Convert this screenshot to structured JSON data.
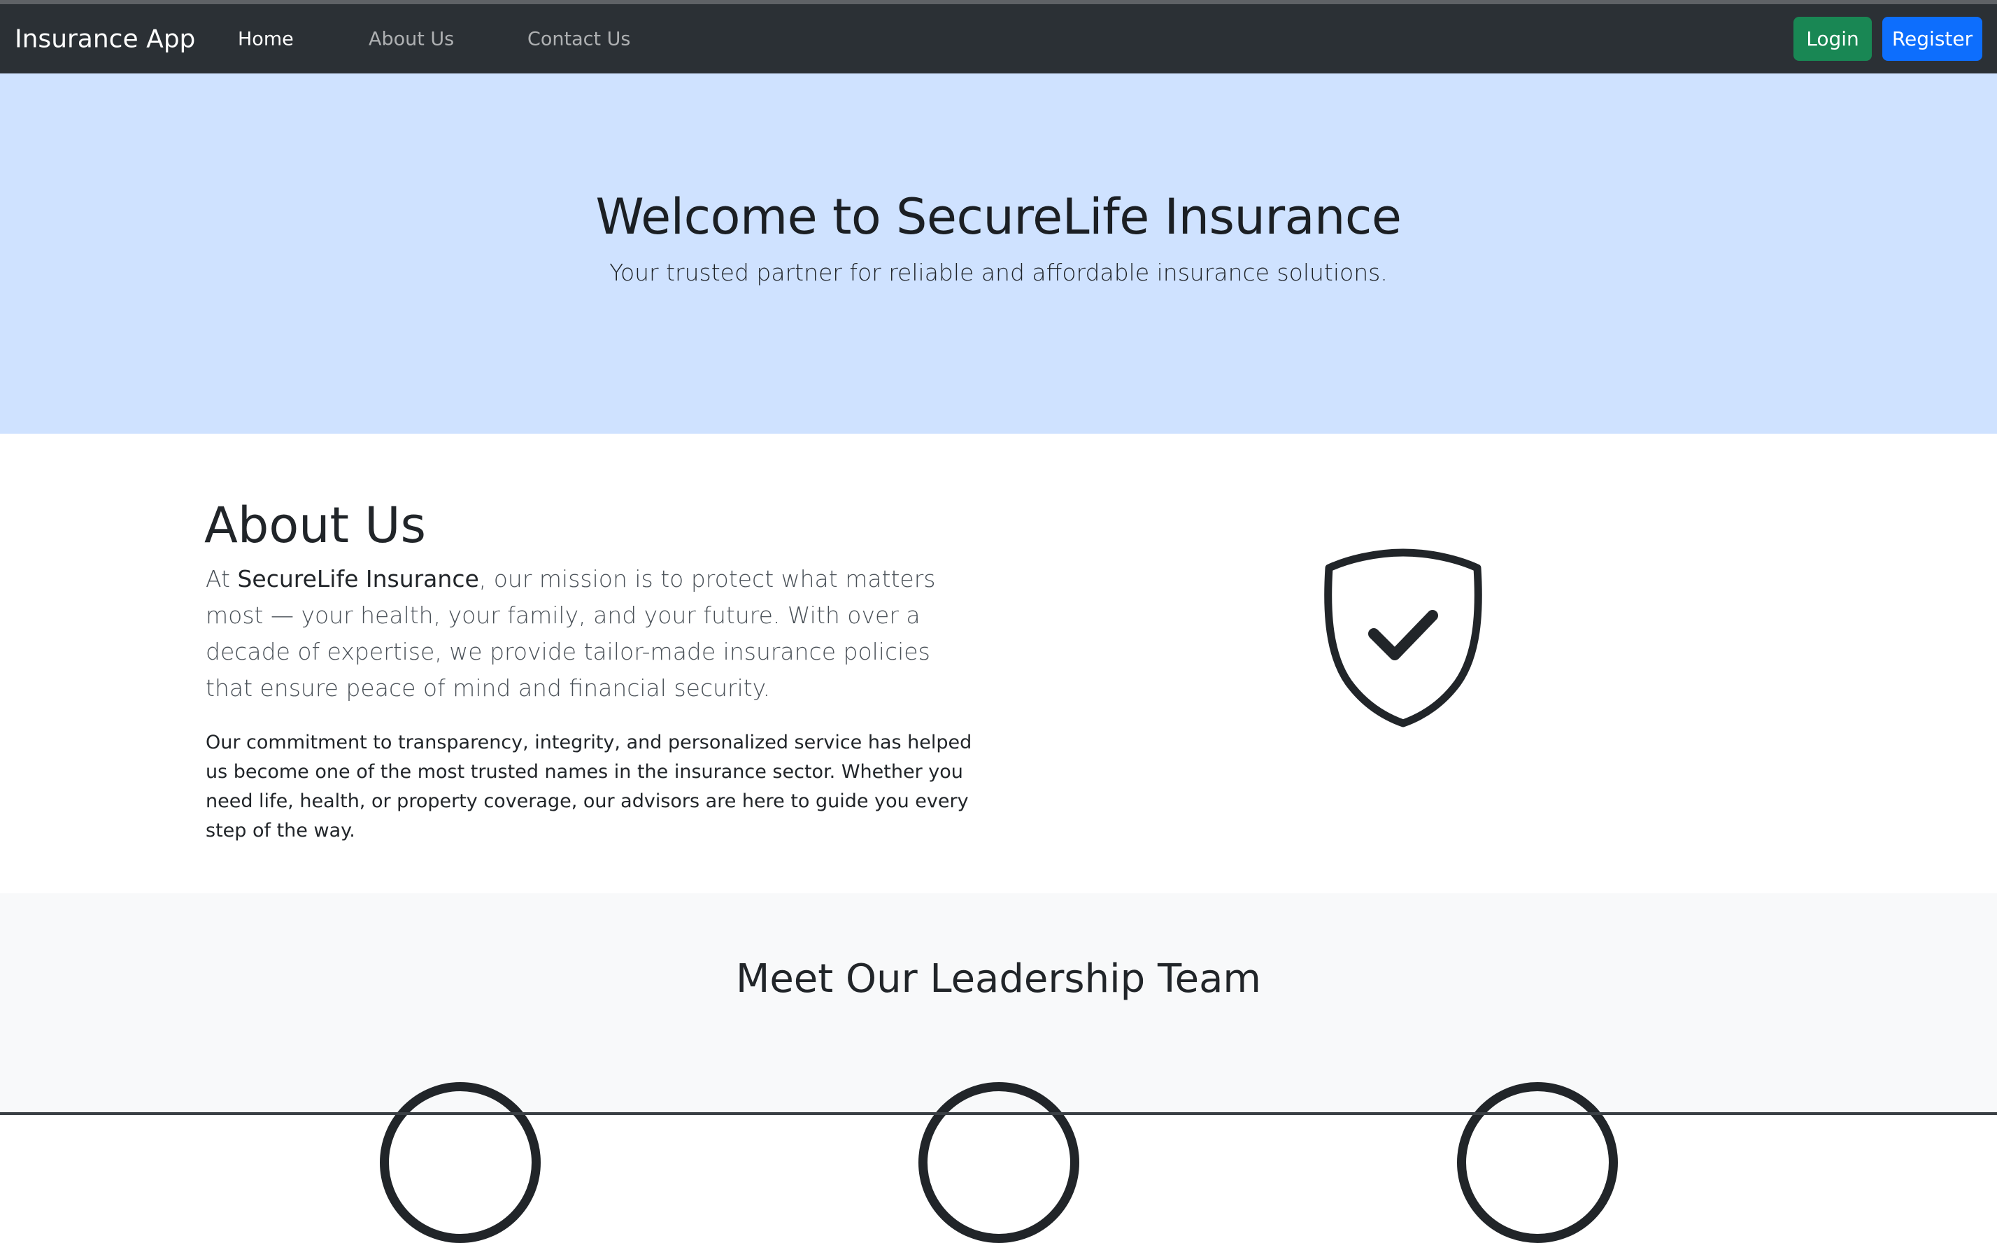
{
  "navbar": {
    "brand": "Insurance App",
    "links": [
      {
        "label": "Home",
        "active": true
      },
      {
        "label": "About Us",
        "active": false
      },
      {
        "label": "Contact Us",
        "active": false
      }
    ],
    "login_label": "Login",
    "register_label": "Register"
  },
  "hero": {
    "title": "Welcome to SecureLife Insurance",
    "subtitle": "Your trusted partner for reliable and affordable insurance solutions."
  },
  "about": {
    "title": "About Us",
    "lead_prefix": "At ",
    "lead_company": "SecureLife Insurance",
    "lead_rest": ", our mission is to protect what matters most — your health, your family, and your future. With over a decade of expertise, we provide tailor-made insurance policies that ensure peace of mind and financial security.",
    "body": "Our commitment to transparency, integrity, and personalized service has helped us become one of the most trusted names in the insurance sector. Whether you need life, health, or property coverage, our advisors are here to guide you every step of the way.",
    "icon": "shield-check-icon"
  },
  "team": {
    "title": "Meet Our Leadership Team",
    "members_icon": "person-circle-icon"
  },
  "colors": {
    "navbar": "#2b3035",
    "hero_bg": "#cfe2ff",
    "login": "#198754",
    "register": "#0d6efd",
    "team_bg": "#f8f9fa"
  }
}
